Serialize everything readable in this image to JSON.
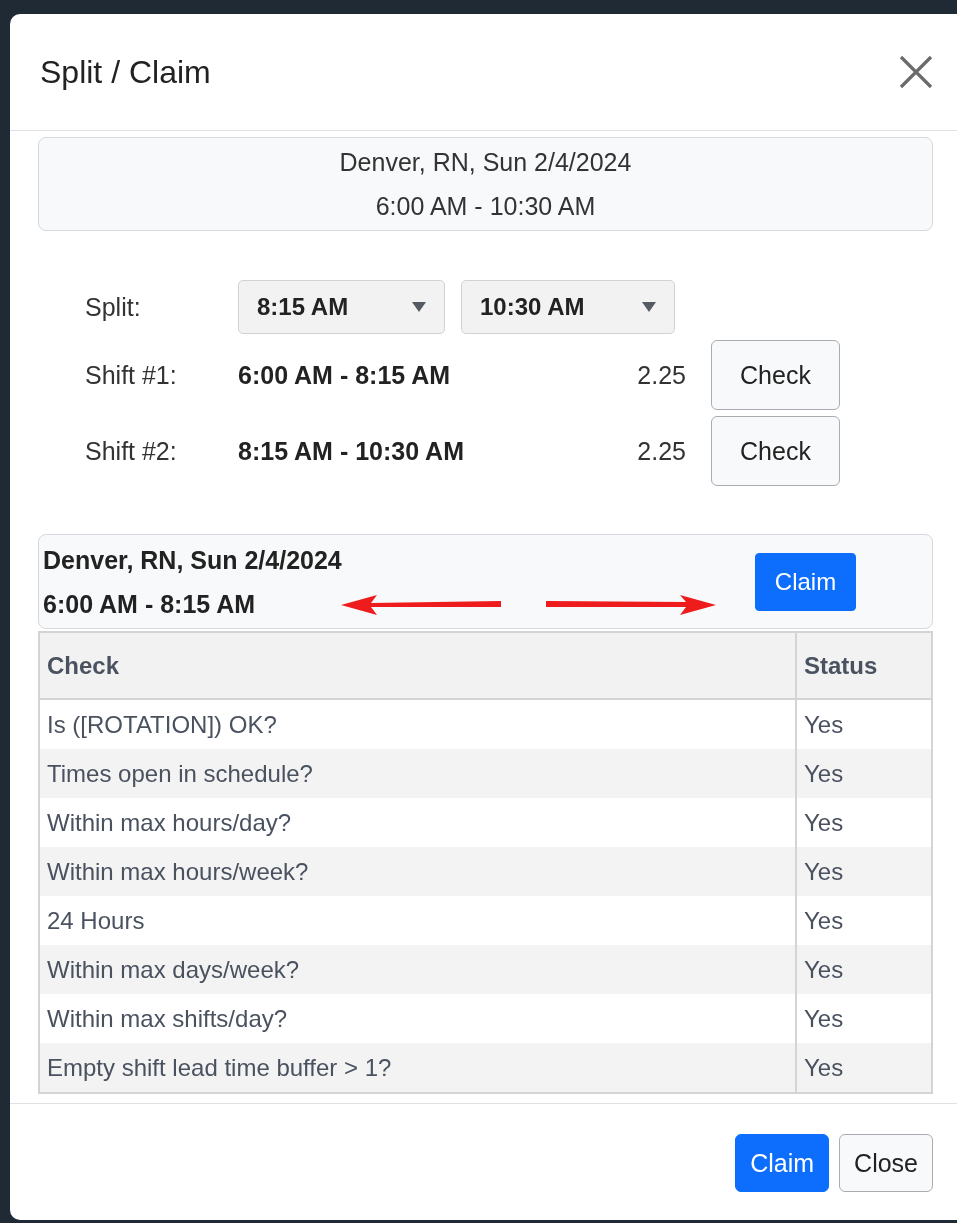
{
  "dialog": {
    "title": "Split / Claim"
  },
  "summary": {
    "line_1": "Denver, RN, Sun 2/4/2024",
    "line_2": "6:00 AM - 10:30 AM"
  },
  "split": {
    "label": "Split:",
    "selects": [
      {
        "value": "8:15 AM"
      },
      {
        "value": "10:30 AM"
      }
    ]
  },
  "shifts": [
    {
      "label": "Shift #1:",
      "times": "6:00 AM - 8:15 AM",
      "hours": "2.25",
      "button": "Check"
    },
    {
      "label": "Shift #2:",
      "times": "8:15 AM - 10:30 AM",
      "hours": "2.25",
      "button": "Check"
    }
  ],
  "selected_shift": {
    "line_1": "Denver, RN, Sun 2/4/2024",
    "line_2": "6:00 AM - 8:15 AM",
    "button": "Claim"
  },
  "table": {
    "columns": [
      "Check",
      "Status"
    ],
    "rows": [
      [
        "Is ([ROTATION]) OK?",
        "Yes"
      ],
      [
        "Times open in schedule?",
        "Yes"
      ],
      [
        "Within max hours/day?",
        "Yes"
      ],
      [
        "Within max hours/week?",
        "Yes"
      ],
      [
        "24 Hours",
        "Yes"
      ],
      [
        "Within max days/week?",
        "Yes"
      ],
      [
        "Within max shifts/day?",
        "Yes"
      ],
      [
        "Empty shift lead time buffer > 1?",
        "Yes"
      ]
    ]
  },
  "footer": {
    "buttons": [
      {
        "label": "Claim",
        "kind": "primary"
      },
      {
        "label": "Close",
        "kind": "secondary"
      }
    ]
  }
}
